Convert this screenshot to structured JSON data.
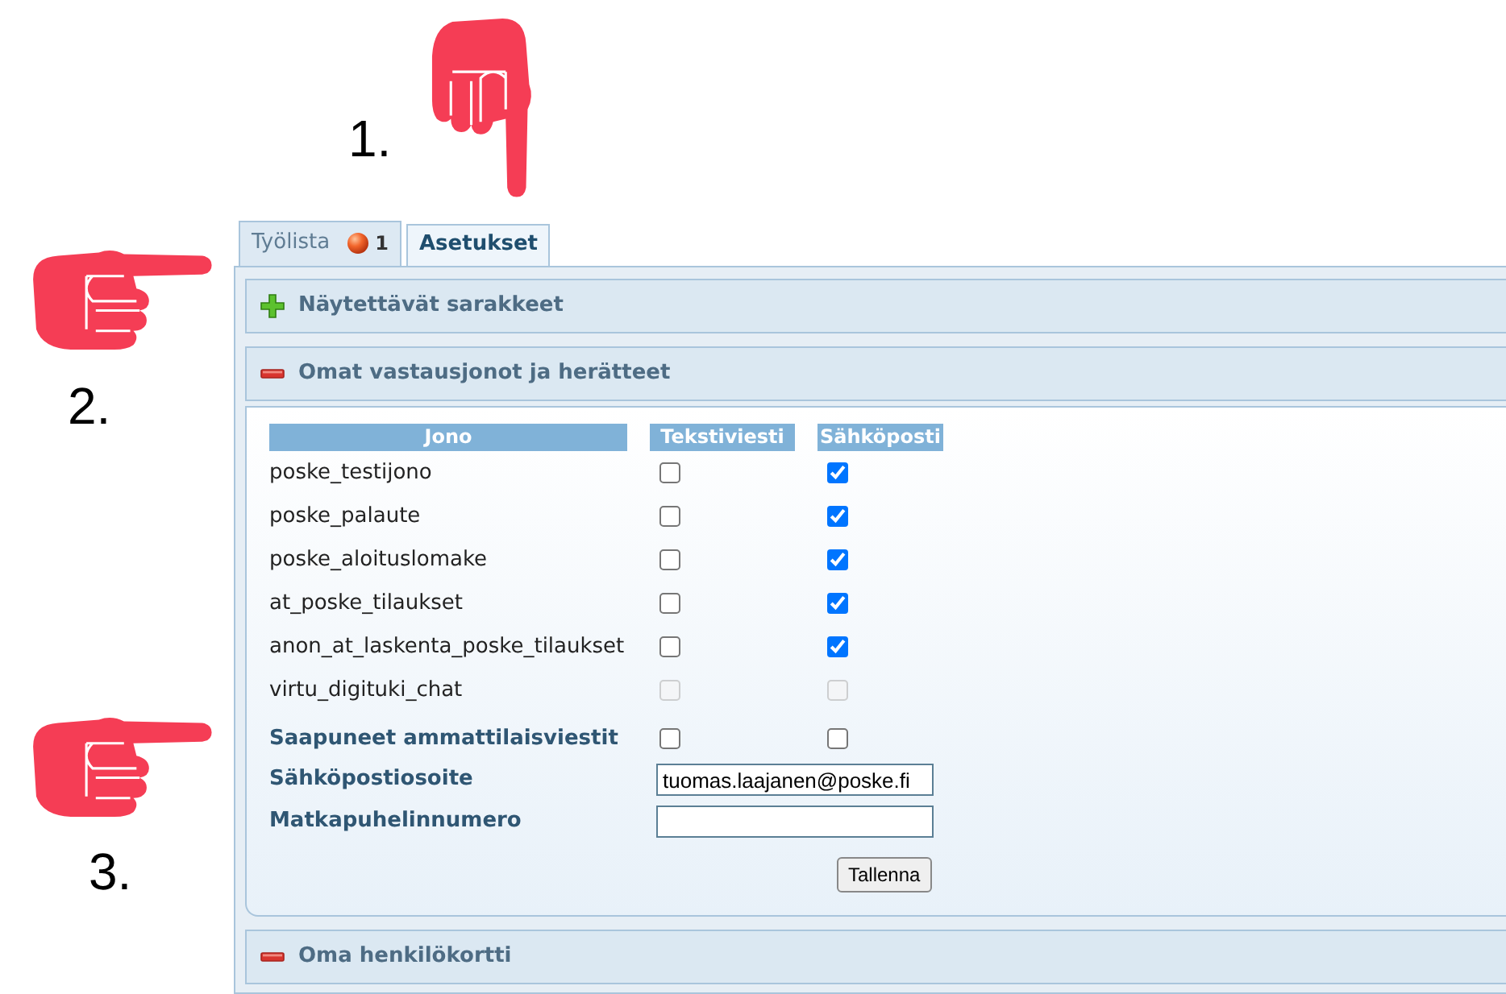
{
  "annotations": [
    {
      "number": "1.",
      "kind": "hand-down"
    },
    {
      "number": "2.",
      "kind": "hand-right"
    },
    {
      "number": "3.",
      "kind": "hand-right"
    }
  ],
  "tabs": [
    {
      "label": "Työlista",
      "badge": "1",
      "selected": false
    },
    {
      "label": "Asetukset",
      "selected": true
    }
  ],
  "sections": [
    {
      "title": "Näytettävät sarakkeet",
      "expanded": false
    },
    {
      "title": "Omat vastausjonot ja herätteet",
      "expanded": true,
      "content": {
        "columns": [
          "Jono",
          "Tekstiviesti",
          "Sähköposti"
        ],
        "rows": [
          {
            "name": "poske_testijono",
            "sms": {
              "checked": false,
              "disabled": false
            },
            "email": {
              "checked": true,
              "disabled": false
            }
          },
          {
            "name": "poske_palaute",
            "sms": {
              "checked": false,
              "disabled": false
            },
            "email": {
              "checked": true,
              "disabled": false
            }
          },
          {
            "name": "poske_aloituslomake",
            "sms": {
              "checked": false,
              "disabled": false
            },
            "email": {
              "checked": true,
              "disabled": false
            }
          },
          {
            "name": "at_poske_tilaukset",
            "sms": {
              "checked": false,
              "disabled": false
            },
            "email": {
              "checked": true,
              "disabled": false
            }
          },
          {
            "name": "anon_at_laskenta_poske_tilaukset",
            "sms": {
              "checked": false,
              "disabled": false
            },
            "email": {
              "checked": true,
              "disabled": false
            }
          },
          {
            "name": "virtu_digituki_chat",
            "sms": {
              "checked": false,
              "disabled": true
            },
            "email": {
              "checked": false,
              "disabled": true
            }
          }
        ],
        "professional_messages": {
          "label": "Saapuneet ammattilaisviestit",
          "sms": {
            "checked": false,
            "disabled": false
          },
          "email": {
            "checked": false,
            "disabled": false
          }
        },
        "fields": [
          {
            "label": "Sähköpostiosoite",
            "value": "tuomas.laajanen@poske.fi"
          },
          {
            "label": "Matkapuhelinnumero"
          }
        ],
        "save_button": "Tallenna"
      }
    },
    {
      "title": "Oma henkilökortti",
      "expanded": true
    }
  ]
}
